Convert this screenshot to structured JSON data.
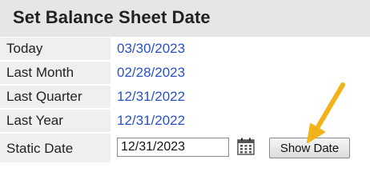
{
  "title": "Set Balance Sheet Date",
  "rows": [
    {
      "label": "Today",
      "value": "03/30/2023"
    },
    {
      "label": "Last Month",
      "value": "02/28/2023"
    },
    {
      "label": "Last Quarter",
      "value": "12/31/2022"
    },
    {
      "label": "Last Year",
      "value": "12/31/2022"
    }
  ],
  "static": {
    "label": "Static Date",
    "input_value": "12/31/2023",
    "button_label": "Show Date"
  },
  "colors": {
    "link": "#2851c9",
    "arrow": "#f2b21a",
    "label_bg": "#efefef",
    "title_bg": "#e6e6e6"
  },
  "icons": {
    "calendar": "calendar-icon",
    "annotation": "arrow-annotation"
  }
}
